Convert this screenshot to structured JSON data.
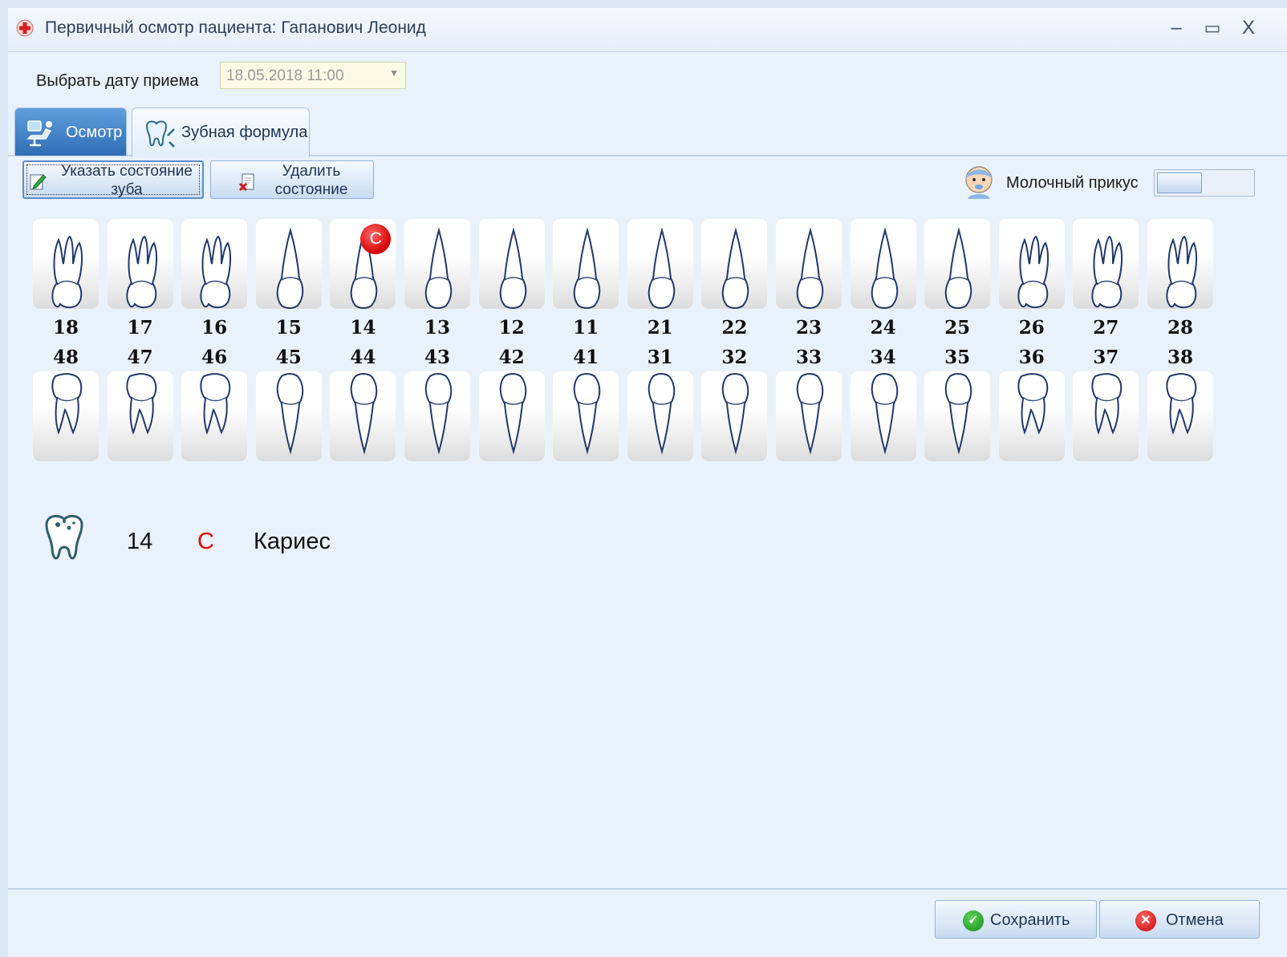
{
  "window": {
    "title": "Первичный осмотр пациента: Гапанович Леонид",
    "minimize": "–",
    "maximize": "▭",
    "close": "X"
  },
  "date": {
    "label": "Выбрать дату приема",
    "value": "18.05.2018 11:00",
    "arrow": "▼"
  },
  "tabs": [
    {
      "label": "Осмотр",
      "active": false
    },
    {
      "label": "Зубная формула",
      "active": true
    }
  ],
  "toolbar": {
    "set_state_label": "Указать состояние зуба",
    "delete_state_label": "Удалить состояние",
    "baby_teeth_label": "Молочный прикус",
    "baby_teeth_enabled": false
  },
  "teeth": {
    "upper": [
      {
        "number": "18",
        "roots": 3
      },
      {
        "number": "17",
        "roots": 3
      },
      {
        "number": "16",
        "roots": 3
      },
      {
        "number": "15",
        "roots": 1
      },
      {
        "number": "14",
        "roots": 1,
        "condition": "C"
      },
      {
        "number": "13",
        "roots": 1
      },
      {
        "number": "12",
        "roots": 1
      },
      {
        "number": "11",
        "roots": 1
      },
      {
        "number": "21",
        "roots": 1
      },
      {
        "number": "22",
        "roots": 1
      },
      {
        "number": "23",
        "roots": 1
      },
      {
        "number": "24",
        "roots": 1
      },
      {
        "number": "25",
        "roots": 1
      },
      {
        "number": "26",
        "roots": 3
      },
      {
        "number": "27",
        "roots": 3
      },
      {
        "number": "28",
        "roots": 3
      }
    ],
    "lower": [
      {
        "number": "48",
        "roots": 2
      },
      {
        "number": "47",
        "roots": 2
      },
      {
        "number": "46",
        "roots": 2
      },
      {
        "number": "45",
        "roots": 1
      },
      {
        "number": "44",
        "roots": 1
      },
      {
        "number": "43",
        "roots": 1
      },
      {
        "number": "42",
        "roots": 1
      },
      {
        "number": "41",
        "roots": 1
      },
      {
        "number": "31",
        "roots": 1
      },
      {
        "number": "32",
        "roots": 1
      },
      {
        "number": "33",
        "roots": 1
      },
      {
        "number": "34",
        "roots": 1
      },
      {
        "number": "35",
        "roots": 1
      },
      {
        "number": "36",
        "roots": 2
      },
      {
        "number": "37",
        "roots": 2
      },
      {
        "number": "38",
        "roots": 2
      }
    ]
  },
  "legend": [
    {
      "tooth": "14",
      "code": "C",
      "description": "Кариес",
      "icon": "decayed-tooth-icon"
    }
  ],
  "footer": {
    "save_label": "Сохранить",
    "cancel_label": "Отмена"
  },
  "colors": {
    "caries": "#e00000",
    "accent": "#2f6db4"
  }
}
